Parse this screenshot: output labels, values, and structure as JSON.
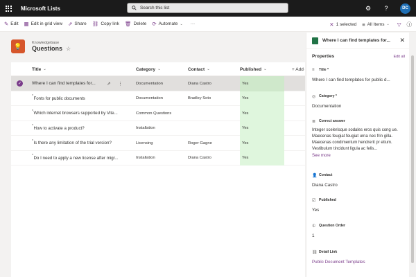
{
  "app": {
    "name": "Microsoft Lists"
  },
  "search": {
    "placeholder": "Search this list"
  },
  "user": {
    "initials": "DC"
  },
  "toolbar": {
    "items": [
      {
        "label": "Edit",
        "icon": "pencil-icon"
      },
      {
        "label": "Edit in grid view",
        "icon": "grid-icon"
      },
      {
        "label": "Share",
        "icon": "share-icon"
      },
      {
        "label": "Copy link",
        "icon": "link-icon"
      },
      {
        "label": "Delete",
        "icon": "trash-icon"
      },
      {
        "label": "Automate",
        "icon": "automate-icon"
      }
    ],
    "more": "···",
    "selected_label": "1 selected",
    "view_label": "All Items"
  },
  "list": {
    "breadcrumb": "Knowledgebase",
    "title": "Questions"
  },
  "table": {
    "columns": [
      "Title",
      "Category",
      "Contact",
      "Published",
      "+ Add column"
    ],
    "rows": [
      {
        "title": "Where I can find templates for...",
        "category": "Documentation",
        "contact": "Diana Castro",
        "published": "Yes",
        "selected": true
      },
      {
        "title": "Fonts for public documents",
        "category": "Documentation",
        "contact": "Bradley Soto",
        "published": "Yes",
        "selected": false
      },
      {
        "title": "Which internet browsers supported by Vite...",
        "category": "Common Questions",
        "contact": "",
        "published": "Yes",
        "selected": false
      },
      {
        "title": "How to activate a product?",
        "category": "Installation",
        "contact": "",
        "published": "Yes",
        "selected": false
      },
      {
        "title": "Is there any limitation of the trial version?",
        "category": "Licensing",
        "contact": "Roger Gagne",
        "published": "Yes",
        "selected": false
      },
      {
        "title": "Do I need to apply a new license after migr...",
        "category": "Installation",
        "contact": "Diana Castro",
        "published": "Yes",
        "selected": false
      }
    ]
  },
  "panel": {
    "title": "Where I can find templates for...",
    "section": "Properties",
    "edit_all": "Edit all",
    "fields": {
      "title": {
        "label": "Title *",
        "value": "Where I can find templates for public d..."
      },
      "category": {
        "label": "Category *",
        "value": "Documentation"
      },
      "answer": {
        "label": "Correct answer",
        "value": "Integer scelerisque sodales eros quis cong ue. Maecenas feugiat feugiat urna nec frin gilla. Maecenas condimentum hendrerit pr etium. Vestibulum tincidunt ligula ac felis...",
        "more": "See more"
      },
      "contact": {
        "label": "Contact",
        "value": "Diana Castro"
      },
      "published": {
        "label": "Published",
        "value": "Yes"
      },
      "order": {
        "label": "Question Order",
        "value": "1"
      },
      "link": {
        "label": "Detail Link",
        "value": "Public Document Templates"
      }
    }
  },
  "colors": {
    "accent": "#7a3b8a",
    "published_bg": "#dff6dd",
    "list_icon": "#d6562b",
    "topbar": "#1b1b1b"
  }
}
